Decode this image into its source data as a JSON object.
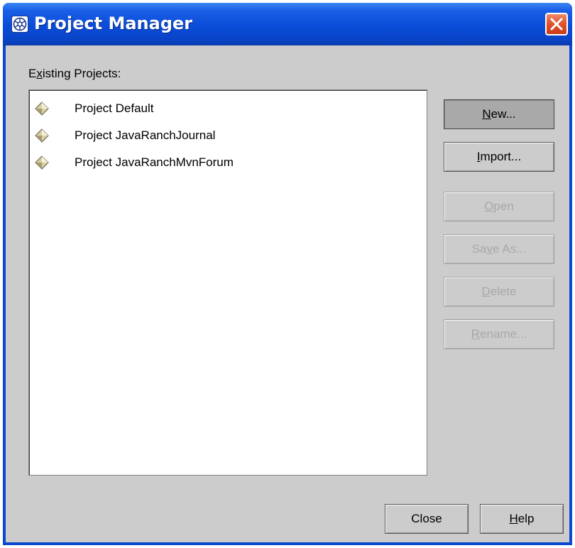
{
  "window": {
    "title": "Project Manager",
    "icon": "project-manager-app-icon",
    "close_icon": "close-icon"
  },
  "list": {
    "label": "Existing Projects:",
    "items": [
      {
        "label": "Project Default",
        "icon": "project-diamond-icon"
      },
      {
        "label": "Project JavaRanchJournal",
        "icon": "project-diamond-icon"
      },
      {
        "label": "Project JavaRanchMvnForum",
        "icon": "project-diamond-icon"
      }
    ]
  },
  "buttons": {
    "new": {
      "label": "New...",
      "enabled": true,
      "pressed": true
    },
    "import": {
      "label": "Import...",
      "enabled": true
    },
    "open": {
      "label": "Open",
      "enabled": false
    },
    "save_as": {
      "label": "Save As...",
      "enabled": false
    },
    "delete": {
      "label": "Delete",
      "enabled": false
    },
    "rename": {
      "label": "Rename...",
      "enabled": false
    },
    "close": {
      "label": "Close",
      "enabled": true
    },
    "help": {
      "label": "Help",
      "enabled": true
    }
  },
  "colors": {
    "title_bar": "#0a4cd8",
    "dialog_background": "#cccccc",
    "list_background": "#ffffff",
    "disabled_text": "#a8a8a8",
    "close_button": "#e0552e"
  }
}
